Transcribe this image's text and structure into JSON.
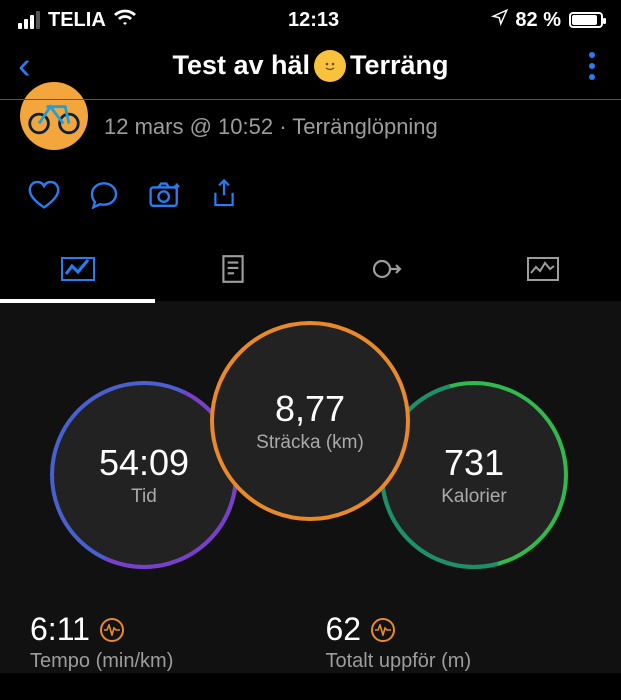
{
  "status": {
    "carrier": "TELIA",
    "time": "12:13",
    "battery_pct": "82 %"
  },
  "nav": {
    "title_left": "Test av häl",
    "title_right": "Terräng"
  },
  "activity": {
    "date_line": "12 mars @ 10:52 · Terränglöpning"
  },
  "circles": {
    "distance": {
      "value": "8,77",
      "label": "Sträcka (km)"
    },
    "time": {
      "value": "54:09",
      "label": "Tid"
    },
    "calories": {
      "value": "731",
      "label": "Kalorier"
    }
  },
  "bottom": {
    "pace": {
      "value": "6:11",
      "label": "Tempo (min/km)"
    },
    "ascent": {
      "value": "62",
      "label": "Totalt uppför (m)"
    }
  }
}
